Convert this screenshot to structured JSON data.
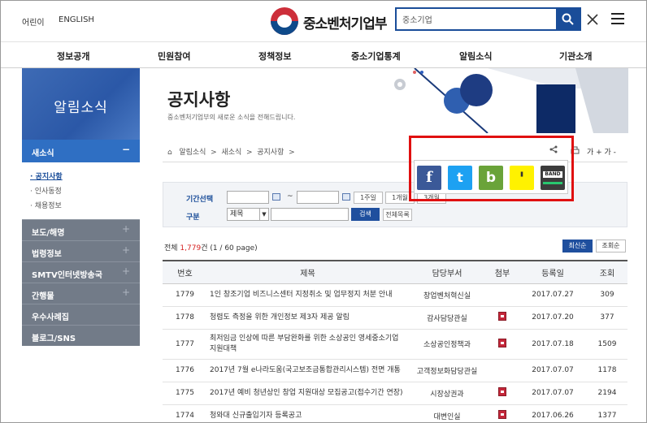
{
  "header": {
    "kids_link": "어린이",
    "english_link": "ENGLISH",
    "logo_text": "중소벤처기업부",
    "search_value": "중소기업"
  },
  "gnb": [
    "정보공개",
    "민원참여",
    "정책정보",
    "중소기업통계",
    "알림소식",
    "기관소개"
  ],
  "sidebar": {
    "title": "알림소식",
    "active": {
      "label": "새소식",
      "toggle": "−"
    },
    "sub": [
      "· 공지사항",
      "· 인사동정",
      "· 채용정보"
    ],
    "items": [
      {
        "label": "보도/해명",
        "toggle": "+"
      },
      {
        "label": "법령정보",
        "toggle": "+"
      },
      {
        "label": "SMTV인터넷방송국",
        "toggle": "+"
      },
      {
        "label": "간행물",
        "toggle": "+"
      },
      {
        "label": "우수사례집",
        "toggle": ""
      },
      {
        "label": "블로그/SNS",
        "toggle": ""
      }
    ]
  },
  "page": {
    "title": "공지사항",
    "description": "중소벤처기업부의 새로운 소식을 전해드립니다.",
    "breadcrumb": [
      "알림소식",
      "새소식",
      "공지사항"
    ],
    "font_controls": "가 +   가 -"
  },
  "filter": {
    "period_label": "기간선택",
    "tilde": "~",
    "period_buttons": [
      "1주일",
      "1개월",
      "3개월"
    ],
    "category_label": "구분",
    "category_value": "제목",
    "search_button": "검색",
    "all_button": "전체목록"
  },
  "share": {
    "facebook": "f",
    "twitter": "t",
    "blog": "b",
    "story": "'",
    "band": "BAND"
  },
  "list": {
    "count_prefix": "전체 ",
    "count_value": "1,779",
    "count_suffix": "건 (1 / 60 page)",
    "sort_latest": "최신순",
    "sort_views": "조회순",
    "columns": [
      "번호",
      "제목",
      "담당부서",
      "첨부",
      "등록일",
      "조회"
    ],
    "rows": [
      {
        "no": "1779",
        "title": "1인 창조기업 비즈니스센터 지정취소 및 업무정지 처분 안내",
        "dept": "창업벤처혁신실",
        "attach": false,
        "date": "2017.07.27",
        "views": "309"
      },
      {
        "no": "1778",
        "title": "청렴도 측정을 위한 개인정보 제3자 제공 알림",
        "dept": "감사담당관실",
        "attach": true,
        "date": "2017.07.20",
        "views": "377"
      },
      {
        "no": "1777",
        "title": "최저임금 인상에 따른 부담완화를 위한 소상공인 영세중소기업 지원대책",
        "dept": "소상공인정책과",
        "attach": true,
        "date": "2017.07.18",
        "views": "1509"
      },
      {
        "no": "1776",
        "title": "2017년 7월 e나라도움(국고보조금통합관리시스템) 전면 개통",
        "dept": "고객정보화담당관실",
        "attach": false,
        "date": "2017.07.07",
        "views": "1178"
      },
      {
        "no": "1775",
        "title": "2017년 예비 청년상인 창업 지원대상 모집공고(접수기간 연장)",
        "dept": "시장상권과",
        "attach": true,
        "date": "2017.07.07",
        "views": "2194"
      },
      {
        "no": "1774",
        "title": "청와대 신규출입기자 등록공고",
        "dept": "대변인실",
        "attach": true,
        "date": "2017.06.26",
        "views": "1377"
      }
    ]
  }
}
